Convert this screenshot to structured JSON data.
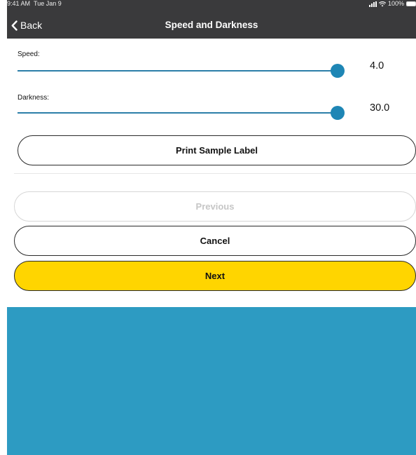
{
  "status_bar": {
    "time": "9:41 AM",
    "date": "Tue Jan 9",
    "battery": "100%",
    "battery_level": 1.0
  },
  "nav": {
    "back_label": "Back",
    "title": "Speed and Darkness"
  },
  "speed": {
    "label": "Speed:",
    "value_text": "4.0",
    "fraction": 1.0
  },
  "darkness": {
    "label": "Darkness:",
    "value_text": "30.0",
    "fraction": 1.0
  },
  "buttons": {
    "print_sample": "Print Sample Label",
    "previous": "Previous",
    "cancel": "Cancel",
    "next": "Next"
  },
  "colors": {
    "nav_bar": "#3a3a3c",
    "slider_accent": "#1e86b5",
    "next_button": "#ffd500",
    "bottom_panel": "#2d9bc2"
  },
  "icons": {
    "back": "chevron-left-icon",
    "signal": "cellular-signal-icon",
    "wifi": "wifi-icon",
    "battery": "battery-icon"
  }
}
